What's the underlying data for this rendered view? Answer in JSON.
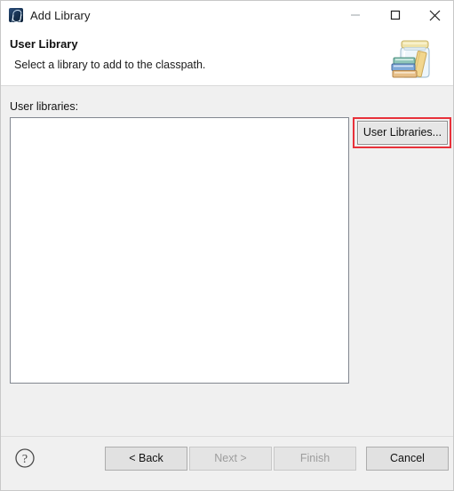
{
  "window": {
    "title": "Add Library",
    "app_icon": "eclipse-java-icon",
    "controls": {
      "minimize": "minimize-icon",
      "maximize": "maximize-icon",
      "close": "close-icon"
    }
  },
  "header": {
    "title": "User Library",
    "description": "Select a library to add to the classpath.",
    "graphic": "jar-with-books-icon"
  },
  "main": {
    "list_label": "User libraries:",
    "list_items": [],
    "list_empty_text": "",
    "user_libraries_button": "User Libraries...",
    "highlight_color": "#e8313a"
  },
  "footer": {
    "help_icon": "help-question-icon",
    "buttons": [
      {
        "label": "< Back",
        "name": "back-button",
        "enabled": true
      },
      {
        "label": "Next >",
        "name": "next-button",
        "enabled": false
      },
      {
        "label": "Finish",
        "name": "finish-button",
        "enabled": false
      },
      {
        "label": "Cancel",
        "name": "cancel-button",
        "enabled": true
      }
    ]
  },
  "colors": {
    "window_bg": "#f0f0f0",
    "header_bg": "#ffffff",
    "accent_red": "#e8313a",
    "text": "#111111",
    "disabled_text": "#9d9d9d"
  }
}
